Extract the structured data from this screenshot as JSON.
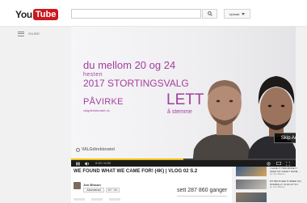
{
  "masthead": {
    "logo_you": "You",
    "logo_tube": "Tube",
    "search_placeholder": "",
    "upload_label": "Upload"
  },
  "guide": {
    "label": "GUIDE"
  },
  "ad": {
    "line1": "du mellom 20 og 24",
    "line2": "hesten",
    "line3": "2017 STORTINGSVALG",
    "paavirke": "PÅVIRKE",
    "url": "valgdirektoratet.no",
    "lett": "LETT",
    "stemme": "å stemme",
    "brand": "VALGdirektoratet",
    "skip_label": "Skip Ad ▶|",
    "accent_color": "#a23fa0"
  },
  "player": {
    "time": "0:10 / 0:20",
    "progress": 0.5
  },
  "video": {
    "title": "WE FOUND WHAT WE CAME FOR! (4K) | VLOG 02 S.2",
    "channel": "Jon Ølsson",
    "subscribe_label": "Abonnerad",
    "subscriber_count": "467 181",
    "views": "sett 287 860 ganger"
  },
  "related": [
    {
      "title": "I GAVE IT 7000 MONEY | WHAT MY FAMILY DONE ...",
      "meta": "av Jon Ølsson"
    },
    {
      "title": "MY BROTHER TURNED 30 | NORMALLY VLOG 07 S.2",
      "meta": "av Jon Ølsson"
    },
    {
      "title": "",
      "meta": ""
    }
  ]
}
